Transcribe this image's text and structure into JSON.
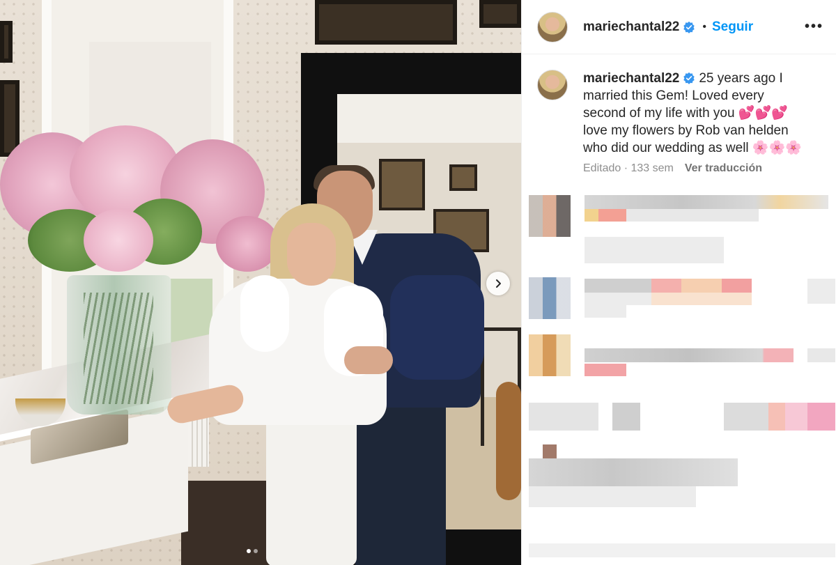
{
  "post": {
    "username": "mariechantal22",
    "follow_label": "Seguir",
    "separator": "•",
    "more_label": "•••",
    "caption_username": "mariechantal22",
    "caption_text": "25 years ago I married this Gem! Loved every second of my life with you 💕💕💕 love my flowers by Rob van helden who did our wedding as well 🌸🌸🌸",
    "meta_edited": "Editado · 133 sem",
    "meta_translate": "Ver traducción"
  },
  "carousel": {
    "total_slides": 2,
    "current_slide": 1
  },
  "colors": {
    "link_blue": "#0095f6",
    "verified_blue": "#3897f0",
    "text": "#262626",
    "muted": "#8e8e8e"
  },
  "icons": {
    "verified": "verified-badge-icon",
    "next": "chevron-right-icon",
    "more": "more-options-icon"
  }
}
